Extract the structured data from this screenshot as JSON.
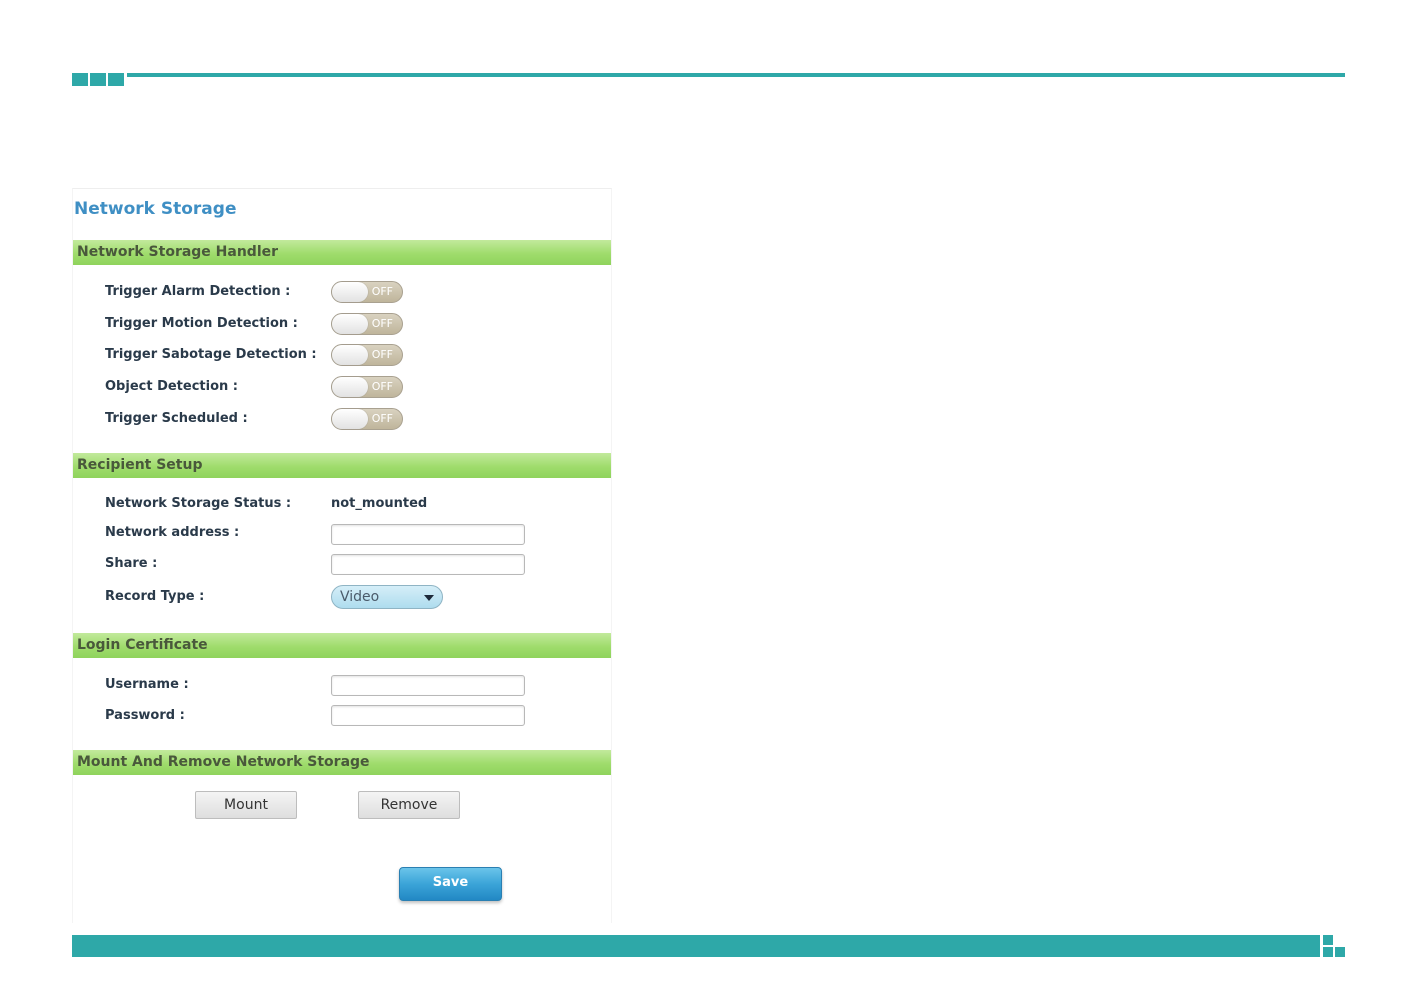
{
  "colors": {
    "accent": "#2ea8a8",
    "title": "#3f8fc4",
    "section_bar": "#9fdc6c"
  },
  "page": {
    "title": "Network Storage"
  },
  "handler": {
    "title": "Network Storage Handler",
    "items": [
      {
        "label": "Trigger Alarm Detection :",
        "state": "OFF"
      },
      {
        "label": "Trigger Motion Detection :",
        "state": "OFF"
      },
      {
        "label": "Trigger Sabotage Detection :",
        "state": "OFF"
      },
      {
        "label": "Object Detection :",
        "state": "OFF"
      },
      {
        "label": "Trigger Scheduled :",
        "state": "OFF"
      }
    ]
  },
  "recipient": {
    "title": "Recipient Setup",
    "status_label": "Network Storage Status :",
    "status_value": "not_mounted",
    "address_label": "Network address :",
    "address_value": "",
    "share_label": "Share :",
    "share_value": "",
    "record_type_label": "Record Type :",
    "record_type_value": "Video"
  },
  "login": {
    "title": "Login Certificate",
    "username_label": "Username :",
    "username_value": "",
    "password_label": "Password :",
    "password_value": ""
  },
  "mount": {
    "title": "Mount And Remove Network Storage",
    "mount_label": "Mount",
    "remove_label": "Remove"
  },
  "save_label": "Save"
}
